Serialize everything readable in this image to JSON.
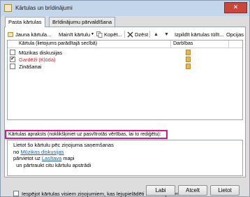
{
  "window": {
    "title": "Kārtulas un brīdinājumi",
    "close_glyph": "✕"
  },
  "tabs": [
    {
      "label": "Pasta kārtulas"
    },
    {
      "label": "Brīdinājumu pārvaldīšana"
    }
  ],
  "toolbar": {
    "new_rule": "Jauna kārtula...",
    "change_rule": "Mainīt kārtulu",
    "copy": "Kopēt...",
    "delete": "Dzēst",
    "run_rules": "Izpildīt kārtulas tūlīt...",
    "options": "Opcijas"
  },
  "rules_table": {
    "col_rule": "Kārtula (lietojums parādītajā secībā)",
    "col_actions": "Darbības",
    "rows": [
      {
        "checked": false,
        "check_glyph": "",
        "name": "Mūzikas diskusijas",
        "color": "#000000",
        "selected": false
      },
      {
        "checked": true,
        "check_glyph": "✔",
        "name": "Gardēži  (Kļūda)",
        "color": "#d0202a",
        "selected": false
      },
      {
        "checked": false,
        "check_glyph": "",
        "name": "Zināšanai",
        "color": "#000000",
        "selected": false
      }
    ]
  },
  "description": {
    "label": "Kārtulas apraksts (noklikšķiniet uz pasvītrotās vērtības, lai to rediģētu):",
    "line1": "Lietot šo kārtulu pēc ziņojuma saņemšanas",
    "line2_prefix": "no ",
    "line2_link": "Mūzikas diskusijas",
    "line3_prefix": "pārvietot uz ",
    "line3_link": "Lasītava",
    "line3_suffix": " mapi",
    "line4": "  un pārtraukt citu kārtulu apstrādi"
  },
  "rss_option": "Iespējot kārtulas visiem ziņojumiem, kas lejupielādēti no RSS plūsmām",
  "buttons": {
    "apply": "Labi",
    "cancel": "Atcelt",
    "apply2": "Lietot"
  },
  "colors": {
    "highlight_border": "#e0148a",
    "error_text": "#d0202a",
    "link": "#1a5fb0"
  }
}
